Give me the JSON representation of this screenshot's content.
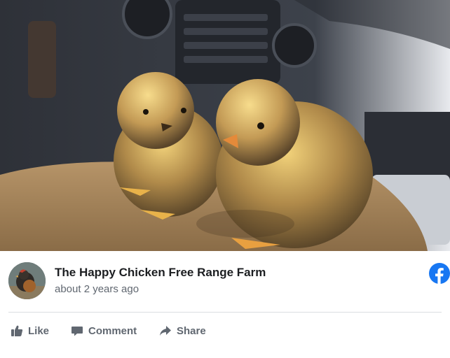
{
  "post": {
    "page_name": "The Happy Chicken Free Range Farm",
    "timestamp": "about 2 years ago",
    "photo": "two-chicks-on-dashboard-photo",
    "avatar": "chicken-avatar"
  },
  "platform": {
    "logo_icon": "facebook-icon",
    "brand_color": "#1877f2"
  },
  "actions": {
    "like": {
      "label": "Like",
      "icon": "thumbs-up-icon"
    },
    "comment": {
      "label": "Comment",
      "icon": "comment-icon"
    },
    "share": {
      "label": "Share",
      "icon": "share-arrow-icon"
    }
  },
  "colors": {
    "text_primary": "#1c1e21",
    "text_secondary": "#606770",
    "divider": "#dadde1"
  }
}
